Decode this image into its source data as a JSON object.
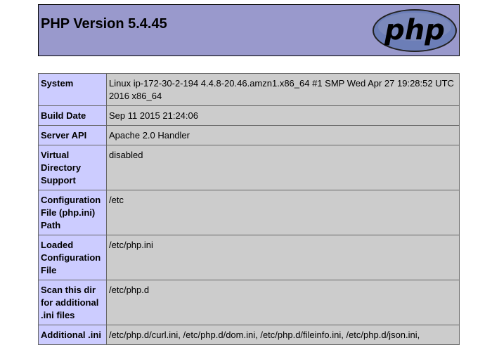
{
  "header": {
    "title": "PHP Version 5.4.45",
    "logo_text": "php"
  },
  "rows": [
    {
      "label": "System",
      "value": "Linux ip-172-30-2-194 4.4.8-20.46.amzn1.x86_64 #1 SMP Wed Apr 27 19:28:52 UTC 2016 x86_64"
    },
    {
      "label": "Build Date",
      "value": "Sep 11 2015 21:24:06"
    },
    {
      "label": "Server API",
      "value": "Apache 2.0 Handler"
    },
    {
      "label": "Virtual Directory Support",
      "value": "disabled"
    },
    {
      "label": "Configuration File (php.ini) Path",
      "value": "/etc"
    },
    {
      "label": "Loaded Configuration File",
      "value": "/etc/php.ini"
    },
    {
      "label": "Scan this dir for additional .ini files",
      "value": "/etc/php.d"
    },
    {
      "label": "Additional .ini",
      "value": "/etc/php.d/curl.ini, /etc/php.d/dom.ini, /etc/php.d/fileinfo.ini, /etc/php.d/json.ini,"
    }
  ],
  "colors": {
    "header_bg": "#9999cc",
    "label_bg": "#ccccff",
    "value_bg": "#cccccc",
    "logo_bg": "#6c7eb7"
  }
}
